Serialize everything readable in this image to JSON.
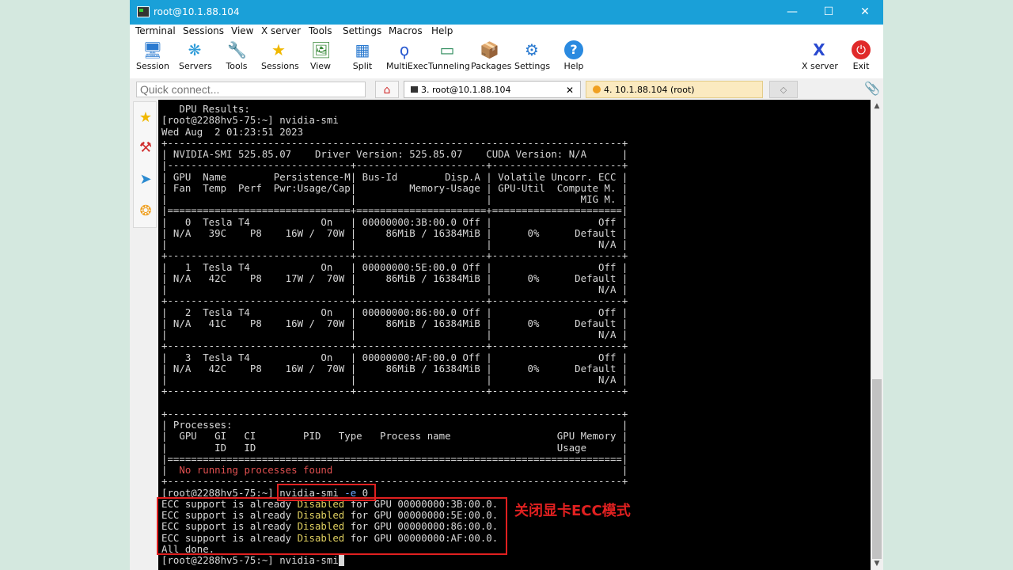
{
  "window": {
    "title": "root@10.1.88.104"
  },
  "menu": [
    "Terminal",
    "Sessions",
    "View",
    "X server",
    "Tools",
    "Settings",
    "Macros",
    "Help"
  ],
  "toolbar": {
    "session": "Session",
    "servers": "Servers",
    "tools": "Tools",
    "sessions": "Sessions",
    "view": "View",
    "split": "Split",
    "multiexec": "MultiExec",
    "tunneling": "Tunneling",
    "packages": "Packages",
    "settings": "Settings",
    "help": "Help",
    "xserver": "X server",
    "exit": "Exit"
  },
  "quick_connect": {
    "placeholder": "Quick connect..."
  },
  "tabs": {
    "tab3": "3. root@10.1.88.104",
    "tab4": "4. 10.1.88.104 (root)"
  },
  "terminal": {
    "l01": "   DPU Results:",
    "l02": "[root@2288hv5-75:~] nvidia-smi",
    "l03": "Wed Aug  2 01:23:51 2023",
    "l04": "+-----------------------------------------------------------------------------+",
    "l05": "| NVIDIA-SMI 525.85.07    Driver Version: 525.85.07    CUDA Version: N/A      |",
    "l06": "|-------------------------------+----------------------+----------------------+",
    "l07": "| GPU  Name        Persistence-M| Bus-Id        Disp.A | Volatile Uncorr. ECC |",
    "l08": "| Fan  Temp  Perf  Pwr:Usage/Cap|         Memory-Usage | GPU-Util  Compute M. |",
    "l09": "|                               |                      |               MIG M. |",
    "l10": "|===============================+======================+======================|",
    "l11": "|   0  Tesla T4            On   | 00000000:3B:00.0 Off |                  Off |",
    "l12": "| N/A   39C    P8    16W /  70W |     86MiB / 16384MiB |      0%      Default |",
    "l13": "|                               |                      |                  N/A |",
    "l14": "+-------------------------------+----------------------+----------------------+",
    "l15": "|   1  Tesla T4            On   | 00000000:5E:00.0 Off |                  Off |",
    "l16": "| N/A   42C    P8    17W /  70W |     86MiB / 16384MiB |      0%      Default |",
    "l17": "|                               |                      |                  N/A |",
    "l18": "+-------------------------------+----------------------+----------------------+",
    "l19": "|   2  Tesla T4            On   | 00000000:86:00.0 Off |                  Off |",
    "l20": "| N/A   41C    P8    16W /  70W |     86MiB / 16384MiB |      0%      Default |",
    "l21": "|                               |                      |                  N/A |",
    "l22": "+-------------------------------+----------------------+----------------------+",
    "l23": "|   3  Tesla T4            On   | 00000000:AF:00.0 Off |                  Off |",
    "l24": "| N/A   42C    P8    16W /  70W |     86MiB / 16384MiB |      0%      Default |",
    "l25": "|                               |                      |                  N/A |",
    "l26": "+-------------------------------+----------------------+----------------------+",
    "l27": "",
    "l28": "+-----------------------------------------------------------------------------+",
    "l29": "| Processes:                                                                  |",
    "l30": "|  GPU   GI   CI        PID   Type   Process name                  GPU Memory |",
    "l31": "|        ID   ID                                                   Usage      |",
    "l32": "|=============================================================================|",
    "l33a": "|  ",
    "l33b": "No running processes found",
    "l33c": "                                                 |",
    "l34": "+-----------------------------------------------------------------------------+",
    "l35a": "[root@2288hv5-75:~] nvidia-smi ",
    "l35b": "-e",
    "l35c": " 0",
    "ecc_prefix": "ECC support is already ",
    "ecc_state": "Disabled",
    "ecc1": " for GPU 00000000:3B:00.0.",
    "ecc2": " for GPU 00000000:5E:00.0.",
    "ecc3": " for GPU 00000000:86:00.0.",
    "ecc4": " for GPU 00000000:AF:00.0.",
    "done": "All done.",
    "last": "[root@2288hv5-75:~] nvidia-smi"
  },
  "annotation": "关闭显卡ECC模式",
  "colors": {
    "titlebar": "#1aa0d8",
    "highlight": "#e02020",
    "disabled_text": "#e0d060"
  }
}
